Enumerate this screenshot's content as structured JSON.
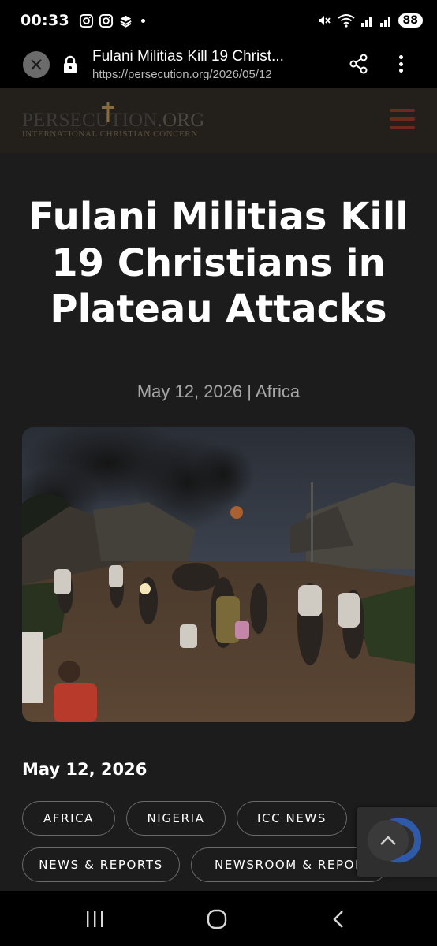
{
  "status_bar": {
    "time": "00:33",
    "battery": "88",
    "left_icons": [
      "instagram-icon",
      "instagram-icon",
      "app-notification-icon"
    ],
    "right_icons": [
      "mute-icon",
      "wifi-icon",
      "signal-icon",
      "signal-icon"
    ]
  },
  "browser": {
    "page_title": "Fulani Militias Kill 19 Christ...",
    "url": "https://persecution.org/2026/05/12"
  },
  "site": {
    "logo_name": "PERSECUTION",
    "logo_domain": ".ORG",
    "logo_tagline": "INTERNATIONAL CHRISTIAN CONCERN",
    "accent_color": "#6b2a1c"
  },
  "article": {
    "title": "Fulani Militias Kill 19 Christians in Plateau Attacks",
    "meta": "May 12, 2026 | Africa",
    "image_alt": "Villagers fleeing at dusk with smoke rising from burning homes",
    "date": "May 12, 2026",
    "tags": [
      "AFRICA",
      "NIGERIA",
      "ICC NEWS",
      "NEWS & REPORTS",
      "NEWSROOM & REPORTS"
    ]
  },
  "nav": {
    "buttons": [
      "recent-apps-icon",
      "home-icon",
      "back-icon"
    ]
  }
}
